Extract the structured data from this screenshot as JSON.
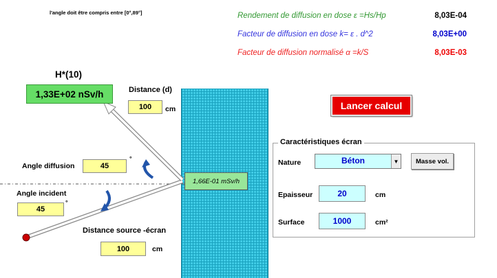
{
  "note": "l'angle doit être compris entre [0°,89°]",
  "results": [
    {
      "label": "Rendement de diffusion en dose ε   =Hs/Hp",
      "value": "8,03E-04",
      "color": "#339933",
      "value_color": "#000000"
    },
    {
      "label": "Facteur de diffusion en dose k= ε . d^2",
      "value": "8,03E+00",
      "color": "#3333dd",
      "value_color": "#0000cc"
    },
    {
      "label": "Facteur de diffusion normalisé α   =k/S",
      "value": "8,03E-03",
      "color": "#ee2222",
      "value_color": "#ee0000"
    }
  ],
  "hstar": {
    "title": "H*(10)",
    "value": "1,33E+02 nSv/h"
  },
  "distance_d": {
    "label": "Distance (d)",
    "value": "100",
    "unit": "cm"
  },
  "angle_diffusion": {
    "label": "Angle diffusion",
    "value": "45",
    "unit": "°"
  },
  "angle_incident": {
    "label": "Angle incident",
    "value": "45",
    "unit": "°"
  },
  "distance_source": {
    "label": "Distance source -écran",
    "value": "100",
    "unit": "cm"
  },
  "wall_dose": "1,66E-01 mSv/h",
  "launch_button": "Lancer calcul",
  "screen": {
    "title": "Caractéristiques écran",
    "nature_label": "Nature",
    "nature_value": "Béton",
    "masse_button": "Masse vol.",
    "epaisseur_label": "Epaisseur",
    "epaisseur_value": "20",
    "epaisseur_unit": "cm",
    "surface_label": "Surface",
    "surface_value": "1000",
    "surface_unit": "cm²"
  }
}
